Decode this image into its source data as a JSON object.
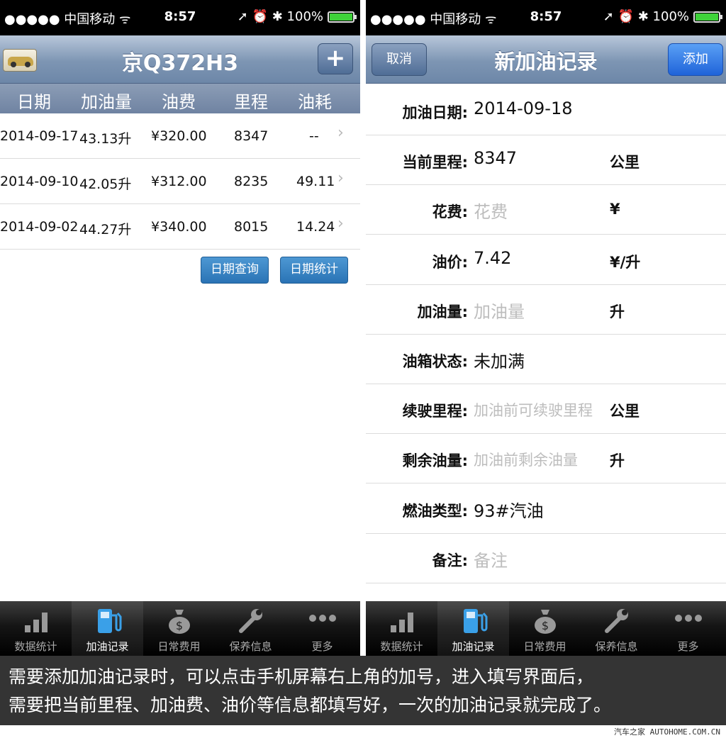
{
  "status_bar": {
    "signal": "●●●●● 中国移动 ᯤ",
    "time": "8:57",
    "right": "➚ ⏰ ✱ 100%"
  },
  "left": {
    "title": "京Q372H3",
    "add_icon": "+",
    "columns": [
      "日期",
      "加油量",
      "油费",
      "里程",
      "油耗"
    ],
    "records": [
      {
        "date": "2014-09-17",
        "amount": "43.13升",
        "fee": "¥320.00",
        "mileage": "8347",
        "consumption": "--"
      },
      {
        "date": "2014-09-10",
        "amount": "42.05升",
        "fee": "¥312.00",
        "mileage": "8235",
        "consumption": "49.11"
      },
      {
        "date": "2014-09-02",
        "amount": "44.27升",
        "fee": "¥340.00",
        "mileage": "8015",
        "consumption": "14.24"
      }
    ],
    "buttons": {
      "date_query": "日期查询",
      "date_stats": "日期统计"
    }
  },
  "right": {
    "cancel": "取消",
    "title": "新加油记录",
    "add": "添加",
    "fields": [
      {
        "label": "加油日期:",
        "value": "2014-09-18",
        "placeholder": false,
        "unit": ""
      },
      {
        "label": "当前里程:",
        "value": "8347",
        "placeholder": false,
        "unit": "公里"
      },
      {
        "label": "花费:",
        "value": "花费",
        "placeholder": true,
        "unit": "¥"
      },
      {
        "label": "油价:",
        "value": "7.42",
        "placeholder": false,
        "unit": "¥/升"
      },
      {
        "label": "加油量:",
        "value": "加油量",
        "placeholder": true,
        "unit": "升"
      },
      {
        "label": "油箱状态:",
        "value": "未加满",
        "placeholder": false,
        "unit": ""
      },
      {
        "label": "续驶里程:",
        "value": "加油前可续驶里程",
        "placeholder": true,
        "unit": "公里"
      },
      {
        "label": "剩余油量:",
        "value": "加油前剩余油量",
        "placeholder": true,
        "unit": "升"
      },
      {
        "label": "燃油类型:",
        "value": "93#汽油",
        "placeholder": false,
        "unit": ""
      },
      {
        "label": "备注:",
        "value": "备注",
        "placeholder": true,
        "unit": ""
      }
    ]
  },
  "tabbar": {
    "items": [
      {
        "label": "数据统计",
        "icon": "bar-chart-icon"
      },
      {
        "label": "加油记录",
        "icon": "fuel-pump-icon"
      },
      {
        "label": "日常费用",
        "icon": "money-bag-icon"
      },
      {
        "label": "保养信息",
        "icon": "wrench-icon"
      },
      {
        "label": "更多",
        "icon": "more-dots-icon"
      }
    ],
    "active_index": 1
  },
  "caption": {
    "line1": "需要添加加油记录时，可以点击手机屏幕右上角的加号，进入填写界面后，",
    "line2": "需要把当前里程、加油费、油价等信息都填写好，一次的加油记录就完成了。"
  },
  "watermark": "汽车之家 AUTOHOME.COM.CN"
}
